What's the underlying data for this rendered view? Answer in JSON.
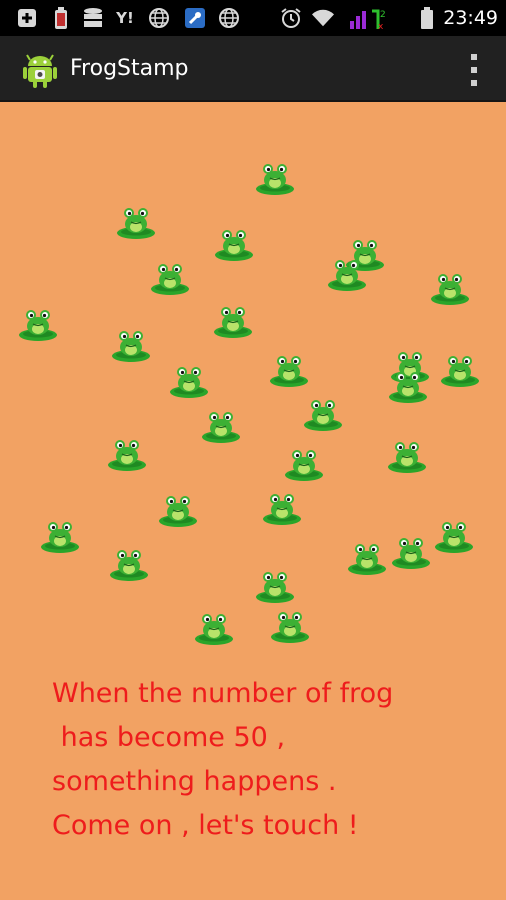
{
  "status_bar": {
    "time": "23:49",
    "left_icons": [
      "add-box-icon",
      "battery-app-icon",
      "storage-icon",
      "yahoo-icon",
      "globe-icon",
      "wrench-icon",
      "globe-icon"
    ],
    "right_icons": [
      "alarm-icon",
      "wifi-icon",
      "signal-icon",
      "battery-icon"
    ]
  },
  "action_bar": {
    "title": "FrogStamp",
    "app_icon": "android-icon",
    "overflow_icon": "more-vert-icon"
  },
  "pond": {
    "frog_icon": "frog-on-lilypad-icon"
  },
  "message": {
    "lines": [
      "When the number of frog",
      " has become 50 ,",
      "something happens .",
      "Come on , let's touch !"
    ],
    "color": "#ee1c1c"
  },
  "colors": {
    "background": "#f2a263",
    "action_bar": "#212121",
    "frog_green": "#3cb034",
    "lilypad_green": "#2aa52a"
  }
}
